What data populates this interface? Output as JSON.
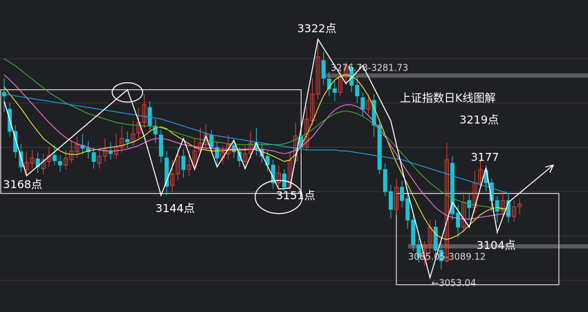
{
  "chart_data": {
    "type": "candlestick",
    "title": "上证指数日K线图解",
    "y_range": [
      3040,
      3335
    ],
    "grid": true,
    "colors": {
      "background": "#1f2023",
      "grid": "#3a3b3f",
      "up": "#e0443f",
      "down": "#19c3d6",
      "annotation": "#ffffff",
      "ma5": "#ffffff",
      "ma10": "#f3e23a",
      "ma20": "#ee6fdf",
      "ma30": "#3aa83a",
      "ma60": "#1e9fe0",
      "resistance_band": "#5a5b5e",
      "support_band": "#5a5b5e"
    },
    "candles": [
      [
        3262,
        3258,
        3278,
        3240
      ],
      [
        3243,
        3218,
        3250,
        3212
      ],
      [
        3218,
        3195,
        3225,
        3188
      ],
      [
        3195,
        3178,
        3204,
        3172
      ],
      [
        3175,
        3183,
        3195,
        3168
      ],
      [
        3182,
        3188,
        3197,
        3176
      ],
      [
        3187,
        3178,
        3194,
        3171
      ],
      [
        3176,
        3186,
        3193,
        3170
      ],
      [
        3184,
        3191,
        3200,
        3178
      ],
      [
        3191,
        3185,
        3203,
        3180
      ],
      [
        3184,
        3180,
        3191,
        3172
      ],
      [
        3180,
        3188,
        3197,
        3175
      ],
      [
        3186,
        3196,
        3208,
        3182
      ],
      [
        3195,
        3203,
        3212,
        3188
      ],
      [
        3202,
        3199,
        3215,
        3192
      ],
      [
        3199,
        3195,
        3207,
        3187
      ],
      [
        3194,
        3184,
        3200,
        3176
      ],
      [
        3182,
        3190,
        3198,
        3176
      ],
      [
        3190,
        3197,
        3210,
        3184
      ],
      [
        3196,
        3193,
        3206,
        3186
      ],
      [
        3192,
        3201,
        3215,
        3187
      ],
      [
        3200,
        3210,
        3224,
        3194
      ],
      [
        3209,
        3206,
        3218,
        3199
      ],
      [
        3206,
        3215,
        3230,
        3202
      ],
      [
        3216,
        3228,
        3245,
        3210
      ],
      [
        3228,
        3248,
        3260,
        3222
      ],
      [
        3245,
        3225,
        3252,
        3219
      ],
      [
        3224,
        3215,
        3232,
        3205
      ],
      [
        3214,
        3190,
        3220,
        3183
      ],
      [
        3188,
        3156,
        3196,
        3146
      ],
      [
        3157,
        3170,
        3186,
        3150
      ],
      [
        3170,
        3190,
        3200,
        3163
      ],
      [
        3190,
        3175,
        3198,
        3166
      ],
      [
        3175,
        3180,
        3197,
        3168
      ],
      [
        3180,
        3196,
        3210,
        3174
      ],
      [
        3196,
        3205,
        3222,
        3192
      ],
      [
        3203,
        3215,
        3226,
        3196
      ],
      [
        3214,
        3200,
        3220,
        3194
      ],
      [
        3200,
        3188,
        3206,
        3180
      ],
      [
        3188,
        3194,
        3202,
        3181
      ],
      [
        3193,
        3203,
        3214,
        3186
      ],
      [
        3202,
        3195,
        3208,
        3188
      ],
      [
        3195,
        3185,
        3200,
        3178
      ],
      [
        3184,
        3193,
        3202,
        3176
      ],
      [
        3193,
        3205,
        3218,
        3187
      ],
      [
        3205,
        3198,
        3222,
        3191
      ],
      [
        3198,
        3190,
        3205,
        3183
      ],
      [
        3190,
        3180,
        3196,
        3173
      ],
      [
        3180,
        3160,
        3186,
        3153
      ],
      [
        3160,
        3171,
        3180,
        3155
      ],
      [
        3170,
        3155,
        3175,
        3151
      ],
      [
        3155,
        3185,
        3196,
        3152
      ],
      [
        3185,
        3213,
        3228,
        3182
      ],
      [
        3212,
        3200,
        3218,
        3193
      ],
      [
        3200,
        3232,
        3246,
        3196
      ],
      [
        3230,
        3260,
        3278,
        3225
      ],
      [
        3260,
        3302,
        3322,
        3254
      ],
      [
        3298,
        3278,
        3308,
        3270
      ],
      [
        3277,
        3266,
        3285,
        3258
      ],
      [
        3266,
        3262,
        3275,
        3252
      ],
      [
        3262,
        3280,
        3290,
        3258
      ],
      [
        3280,
        3292,
        3296,
        3271
      ],
      [
        3290,
        3270,
        3295,
        3262
      ],
      [
        3270,
        3258,
        3280,
        3250
      ],
      [
        3256,
        3243,
        3262,
        3235
      ],
      [
        3243,
        3253,
        3260,
        3238
      ],
      [
        3253,
        3225,
        3260,
        3212
      ],
      [
        3225,
        3175,
        3232,
        3170
      ],
      [
        3175,
        3150,
        3182,
        3145
      ],
      [
        3150,
        3130,
        3158,
        3120
      ],
      [
        3130,
        3155,
        3165,
        3124
      ],
      [
        3155,
        3140,
        3162,
        3132
      ],
      [
        3142,
        3118,
        3148,
        3108
      ],
      [
        3118,
        3090,
        3125,
        3083
      ],
      [
        3090,
        3076,
        3098,
        3070
      ],
      [
        3076,
        3090,
        3094,
        3066
      ],
      [
        3090,
        3110,
        3118,
        3080
      ],
      [
        3110,
        3084,
        3118,
        3078
      ],
      [
        3084,
        3072,
        3092,
        3062
      ],
      [
        3072,
        3186,
        3205,
        3070
      ],
      [
        3182,
        3125,
        3190,
        3118
      ],
      [
        3126,
        3110,
        3135,
        3098
      ],
      [
        3110,
        3138,
        3150,
        3104
      ],
      [
        3140,
        3132,
        3148,
        3118
      ],
      [
        3132,
        3160,
        3174,
        3126
      ],
      [
        3160,
        3175,
        3185,
        3155
      ],
      [
        3174,
        3160,
        3180,
        3150
      ],
      [
        3160,
        3140,
        3165,
        3128
      ],
      [
        3140,
        3128,
        3145,
        3115
      ],
      [
        3128,
        3140,
        3150,
        3120
      ],
      [
        3140,
        3122,
        3148,
        3115
      ],
      [
        3122,
        3133,
        3140,
        3116
      ],
      [
        3133,
        3136,
        3142,
        3125
      ]
    ],
    "moving_averages": {
      "ma5": [
        3256,
        3238,
        3220,
        3208,
        3199,
        3188,
        3185,
        3182,
        3184,
        3186,
        3184,
        3186,
        3188,
        3190,
        3195,
        3198,
        3196,
        3192,
        3193,
        3195,
        3197,
        3202,
        3208,
        3212,
        3218,
        3229,
        3234,
        3229,
        3217,
        3193,
        3172,
        3167,
        3172,
        3178,
        3183,
        3194,
        3200,
        3201,
        3202,
        3200,
        3197,
        3197,
        3197,
        3199,
        3202,
        3199,
        3196,
        3190,
        3180,
        3174,
        3171,
        3181,
        3196,
        3212,
        3236,
        3261,
        3288,
        3292,
        3290,
        3276,
        3270,
        3272,
        3268,
        3260,
        3252,
        3240,
        3212,
        3192,
        3168,
        3145,
        3138,
        3130,
        3116,
        3100,
        3084,
        3075,
        3080,
        3088,
        3095,
        3110,
        3122,
        3128,
        3134,
        3142,
        3148,
        3150,
        3145,
        3138,
        3132,
        3130,
        3128
      ],
      "ma10": [
        3268,
        3260,
        3252,
        3244,
        3235,
        3226,
        3218,
        3210,
        3205,
        3200,
        3196,
        3193,
        3192,
        3192,
        3194,
        3196,
        3197,
        3198,
        3199,
        3200,
        3201,
        3202,
        3204,
        3206,
        3209,
        3213,
        3218,
        3222,
        3223,
        3221,
        3216,
        3212,
        3208,
        3204,
        3200,
        3198,
        3197,
        3196,
        3196,
        3196,
        3197,
        3197,
        3197,
        3197,
        3198,
        3197,
        3195,
        3193,
        3190,
        3187,
        3184,
        3186,
        3192,
        3202,
        3214,
        3228,
        3244,
        3258,
        3268,
        3276,
        3280,
        3282,
        3280,
        3276,
        3268,
        3258,
        3245,
        3230,
        3214,
        3198,
        3183,
        3170,
        3158,
        3145,
        3132,
        3120,
        3110,
        3102,
        3098,
        3096,
        3098,
        3101,
        3106,
        3112,
        3118,
        3124,
        3128,
        3131,
        3132,
        3131,
        3130
      ],
      "ma20": [
        3282,
        3276,
        3270,
        3263,
        3256,
        3249,
        3242,
        3235,
        3228,
        3222,
        3216,
        3211,
        3207,
        3204,
        3202,
        3200,
        3198,
        3197,
        3196,
        3196,
        3196,
        3197,
        3198,
        3200,
        3202,
        3205,
        3208,
        3210,
        3210,
        3209,
        3207,
        3205,
        3203,
        3202,
        3201,
        3200,
        3199,
        3199,
        3198,
        3198,
        3198,
        3198,
        3198,
        3198,
        3198,
        3198,
        3198,
        3197,
        3196,
        3194,
        3193,
        3194,
        3197,
        3201,
        3206,
        3212,
        3220,
        3228,
        3236,
        3242,
        3246,
        3248,
        3248,
        3246,
        3242,
        3236,
        3229,
        3221,
        3212,
        3202,
        3192,
        3182,
        3172,
        3163,
        3154,
        3146,
        3139,
        3132,
        3127,
        3123,
        3121,
        3120,
        3119,
        3119,
        3120,
        3121,
        3122,
        3123,
        3124,
        3125,
        3125
      ],
      "ma30": [
        3300,
        3296,
        3292,
        3287,
        3282,
        3277,
        3272,
        3267,
        3262,
        3258,
        3254,
        3250,
        3247,
        3244,
        3241,
        3238,
        3236,
        3234,
        3232,
        3230,
        3228,
        3227,
        3226,
        3225,
        3225,
        3224,
        3224,
        3223,
        3222,
        3220,
        3218,
        3216,
        3214,
        3212,
        3210,
        3209,
        3208,
        3207,
        3206,
        3205,
        3204,
        3204,
        3203,
        3203,
        3203,
        3203,
        3203,
        3203,
        3203,
        3203,
        3204,
        3206,
        3209,
        3212,
        3216,
        3220,
        3225,
        3230,
        3234,
        3238,
        3240,
        3241,
        3240,
        3238,
        3235,
        3231,
        3226,
        3220,
        3214,
        3207,
        3200,
        3193,
        3186,
        3179,
        3172,
        3166,
        3160,
        3155,
        3150,
        3146,
        3143,
        3140,
        3138,
        3136,
        3135,
        3134,
        3133,
        3132,
        3131,
        3130,
        3130
      ],
      "ma60": [
        3260,
        3259,
        3258,
        3257,
        3256,
        3255,
        3254,
        3253,
        3252,
        3251,
        3250,
        3249,
        3248,
        3247,
        3246,
        3245,
        3244,
        3243,
        3242,
        3241,
        3240,
        3239,
        3238,
        3237,
        3236,
        3235,
        3234,
        3233,
        3232,
        3230,
        3228,
        3226,
        3224,
        3222,
        3220,
        3218,
        3216,
        3214,
        3213,
        3212,
        3211,
        3210,
        3209,
        3208,
        3207,
        3206,
        3205,
        3204,
        3203,
        3202,
        3201,
        3200,
        3199,
        3198,
        3197,
        3197,
        3197,
        3197,
        3197,
        3197,
        3196,
        3196,
        3195,
        3194,
        3193,
        3192,
        3191,
        3190,
        3189,
        3188,
        3187,
        3186,
        3184,
        3182,
        3180,
        3178,
        3176,
        3174,
        3172,
        3170,
        3168,
        3166,
        3164,
        3162,
        3160,
        3158,
        3156,
        3154,
        3152,
        3150,
        3148
      ]
    },
    "zigzag_wave": [
      [
        0,
        3252
      ],
      [
        4,
        3168
      ],
      [
        22,
        3265
      ],
      [
        25,
        3212
      ],
      [
        28,
        3146
      ],
      [
        32,
        3210
      ],
      [
        34,
        3175
      ],
      [
        36,
        3213
      ],
      [
        38,
        3178
      ],
      [
        41,
        3208
      ],
      [
        43,
        3176
      ],
      [
        45,
        3205
      ],
      [
        49,
        3153
      ],
      [
        51,
        3154
      ],
      [
        56,
        3322
      ],
      [
        61,
        3272
      ],
      [
        64,
        3292
      ],
      [
        69,
        3230
      ],
      [
        72,
        3150
      ],
      [
        76,
        3053
      ],
      [
        80,
        3138
      ],
      [
        83,
        3110
      ],
      [
        86,
        3177
      ],
      [
        88,
        3104
      ],
      [
        90,
        3138
      ]
    ],
    "projection_arrow": [
      [
        90,
        3138
      ],
      [
        98,
        3180
      ]
    ],
    "price_labels": [
      {
        "text": "3322点",
        "index": 56,
        "price": 3322
      },
      {
        "text": "3219点",
        "index": 83,
        "price": 3219
      },
      {
        "text": "3177",
        "index": 86,
        "price": 3177
      },
      {
        "text": "3168点",
        "index": 4,
        "price": 3168
      },
      {
        "text": "3144点",
        "index": 28,
        "price": 3144
      },
      {
        "text": "3151点",
        "index": 50,
        "price": 3151
      },
      {
        "text": "3104点",
        "index": 88,
        "price": 3104
      }
    ],
    "resistance_band": {
      "text": "3276.78-3281.73",
      "low": 3276.78,
      "high": 3281.73
    },
    "support_band": {
      "text": "3085.05-3089.12",
      "low": 3085.05,
      "high": 3089.12
    },
    "low_marker": {
      "text": "←3053.04",
      "index": 76,
      "price": 3053.04
    },
    "highlight_circles": [
      {
        "index": 22,
        "price": 3262
      },
      {
        "index": 49,
        "price": 3155
      }
    ],
    "range_boxes": [
      {
        "from_index": 0,
        "to_index": 53,
        "top": 3265,
        "bottom": 3148
      },
      {
        "from_index": 70,
        "to_index": 99,
        "top": 3148,
        "bottom": 3045
      }
    ]
  }
}
